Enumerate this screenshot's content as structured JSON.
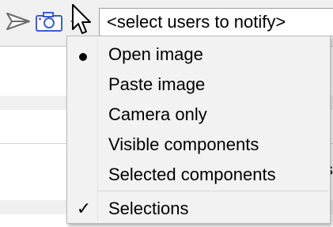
{
  "toolbar": {
    "send_icon": "send-arrow-icon",
    "camera_icon": "camera-icon",
    "dropdown_icon": "dropdown-arrow-icon",
    "notify_select": {
      "value": "<select users to notify>"
    },
    "cursor_icon": "mouse-pointer-icon"
  },
  "background": {
    "tail_text": "s"
  },
  "menu": {
    "items": [
      {
        "label": "Open image",
        "mark": "radio-dot",
        "selected": true
      },
      {
        "label": "Paste image"
      },
      {
        "label": "Camera only"
      },
      {
        "label": "Visible components"
      },
      {
        "label": "Selected components"
      },
      {
        "label": "Selections",
        "mark": "check",
        "check_glyph": "✓",
        "checked": true
      }
    ]
  },
  "colors": {
    "menu_bg": "#f2f2f2",
    "toolbar_bg": "#f0f0f0",
    "icon_blue": "#3a5fc8",
    "icon_gray": "#6b6b6b"
  }
}
